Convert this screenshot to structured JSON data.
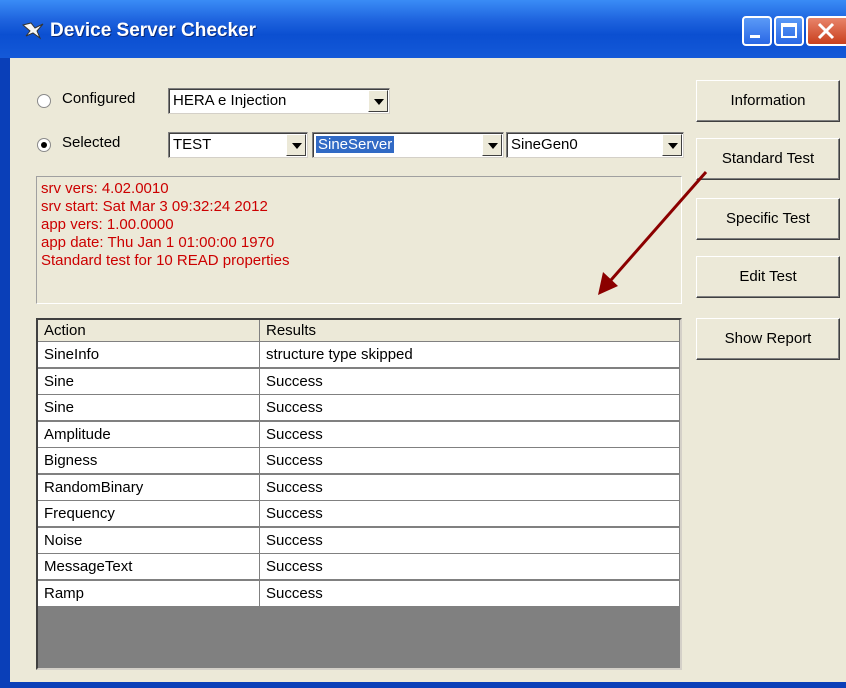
{
  "window": {
    "title": "Device Server Checker"
  },
  "source": {
    "configured_label": "Configured",
    "configured_value": "HERA e Injection",
    "selected_label": "Selected",
    "context_value": "TEST",
    "server_value": "SineServer",
    "device_value": "SineGen0",
    "mode": "selected"
  },
  "info_lines": [
    "srv vers: 4.02.0010",
    "srv start: Sat Mar  3 09:32:24 2012",
    "app vers: 1.00.0000",
    "app date: Thu Jan  1 01:00:00 1970",
    "Standard test for  10 READ properties"
  ],
  "table": {
    "headers": [
      "Action",
      "Results"
    ],
    "rows": [
      [
        "SineInfo",
        "structure type skipped"
      ],
      [
        "Sine",
        "Success"
      ],
      [
        "Sine",
        "Success"
      ],
      [
        "Amplitude",
        "Success"
      ],
      [
        "Bigness",
        "Success"
      ],
      [
        "RandomBinary",
        "Success"
      ],
      [
        "Frequency",
        "Success"
      ],
      [
        "Noise",
        "Success"
      ],
      [
        "MessageText",
        "Success"
      ],
      [
        "Ramp",
        "Success"
      ]
    ]
  },
  "buttons": {
    "information": "Information",
    "standard_test": "Standard Test",
    "specific_test": "Specific Test",
    "edit_test": "Edit Test",
    "show_report": "Show Report"
  },
  "colors": {
    "info_text": "#cc0000",
    "arrow": "#8b0000",
    "selection": "#316ac5"
  }
}
